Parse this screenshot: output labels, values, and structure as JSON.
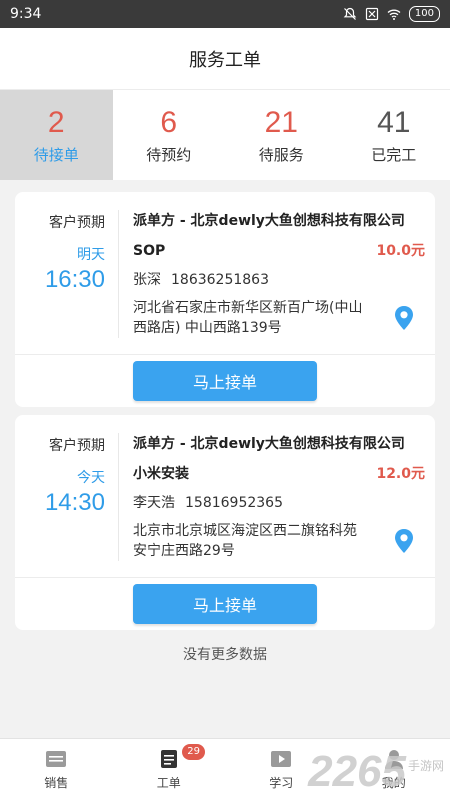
{
  "status_bar": {
    "time": "9:34",
    "battery": "100"
  },
  "app_title": "服务工单",
  "tabs": [
    {
      "count": "2",
      "label": "待接单",
      "active": true
    },
    {
      "count": "6",
      "label": "待预约"
    },
    {
      "count": "21",
      "label": "待服务"
    },
    {
      "count": "41",
      "label": "已完工"
    }
  ],
  "orders": [
    {
      "expect_label": "客户预期",
      "day": "明天",
      "time": "16:30",
      "dispatcher": "派单方 - 北京dewly大鱼创想科技有限公司",
      "service": "SOP",
      "price": "10.0元",
      "contact_name": "张深",
      "contact_phone": "18636251863",
      "address": "河北省石家庄市新华区新百广场(中山西路店) 中山西路139号",
      "accept_label": "马上接单"
    },
    {
      "expect_label": "客户预期",
      "day": "今天",
      "time": "14:30",
      "dispatcher": "派单方 - 北京dewly大鱼创想科技有限公司",
      "service": "小米安装",
      "price": "12.0元",
      "contact_name": "李天浩",
      "contact_phone": "15816952365",
      "address": "北京市北京城区海淀区西二旗铭科苑 安宁庄西路29号",
      "accept_label": "马上接单"
    }
  ],
  "no_more": "没有更多数据",
  "bottom_nav": [
    {
      "label": "销售",
      "icon": "sales-icon"
    },
    {
      "label": "工单",
      "icon": "workorder-icon",
      "badge": "29"
    },
    {
      "label": "学习",
      "icon": "study-icon"
    },
    {
      "label": "我的",
      "icon": "profile-icon"
    }
  ],
  "watermark": {
    "number": "2265",
    "text": "手游网"
  }
}
